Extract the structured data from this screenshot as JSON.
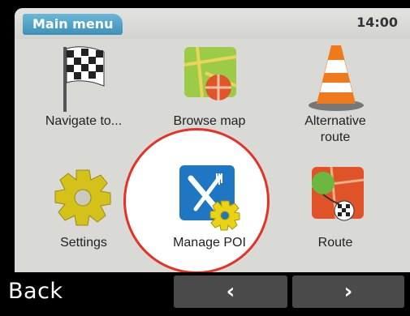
{
  "header": {
    "title": "Main menu",
    "time": "14:00"
  },
  "menu": {
    "items": [
      {
        "label": "Navigate to...",
        "icon": "checkered-flag-icon"
      },
      {
        "label": "Browse map",
        "icon": "map-icon"
      },
      {
        "label_line1": "Alternative",
        "label_line2": "route",
        "icon": "traffic-cone-icon"
      },
      {
        "label": "Settings",
        "icon": "gear-icon"
      },
      {
        "label": "Manage POI",
        "icon": "poi-knife-fork-icon",
        "highlighted": true
      },
      {
        "label": "Route",
        "icon": "route-map-icon"
      }
    ]
  },
  "footer": {
    "back_label": "Back",
    "prev_symbol": "‹",
    "next_symbol": "›"
  },
  "colors": {
    "accent": "#3d91ba",
    "highlight_ring": "#e43225"
  }
}
